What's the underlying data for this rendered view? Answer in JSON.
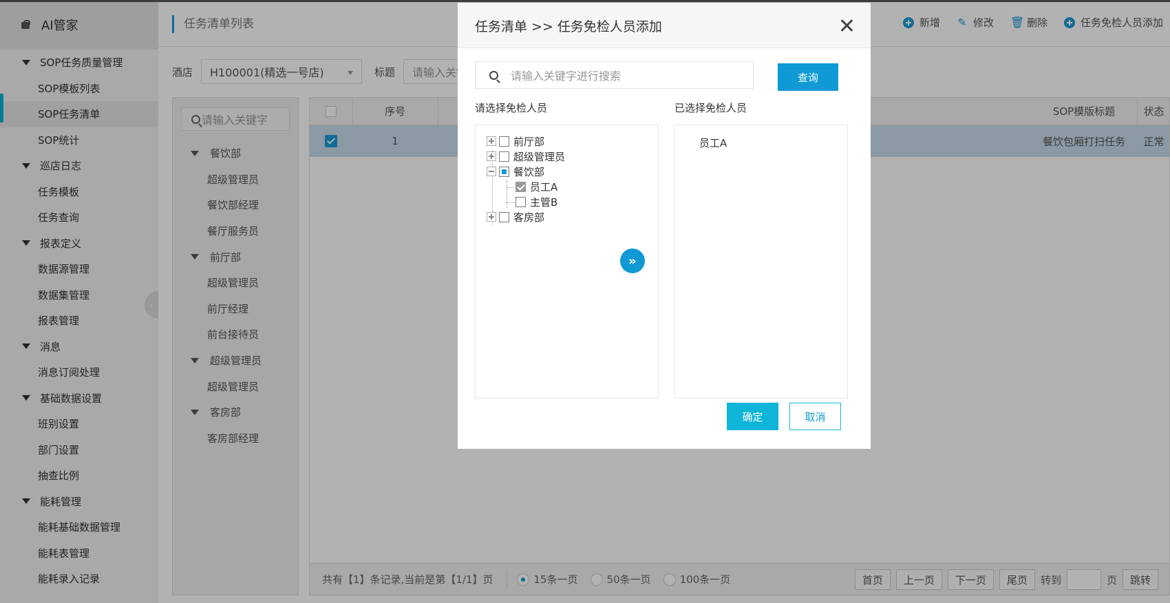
{
  "sidebar": {
    "brand": "AI管家",
    "items": [
      {
        "label": "SOP任务质量管理",
        "type": "group"
      },
      {
        "label": "SOP模板列表",
        "type": "child"
      },
      {
        "label": "SOP任务清单",
        "type": "child",
        "active": true
      },
      {
        "label": "SOP统计",
        "type": "child"
      },
      {
        "label": "巡店日志",
        "type": "group"
      },
      {
        "label": "任务模板",
        "type": "child"
      },
      {
        "label": "任务查询",
        "type": "child"
      },
      {
        "label": "报表定义",
        "type": "group"
      },
      {
        "label": "数据源管理",
        "type": "child"
      },
      {
        "label": "数据集管理",
        "type": "child"
      },
      {
        "label": "报表管理",
        "type": "child"
      },
      {
        "label": "消息",
        "type": "group"
      },
      {
        "label": "消息订阅处理",
        "type": "child"
      },
      {
        "label": "基础数据设置",
        "type": "group"
      },
      {
        "label": "班别设置",
        "type": "child"
      },
      {
        "label": "部门设置",
        "type": "child"
      },
      {
        "label": "抽查比例",
        "type": "child"
      },
      {
        "label": "能耗管理",
        "type": "group"
      },
      {
        "label": "能耗基础数据管理",
        "type": "child"
      },
      {
        "label": "能耗表管理",
        "type": "child"
      },
      {
        "label": "能耗录入记录",
        "type": "child"
      }
    ]
  },
  "header": {
    "title": "任务清单列表",
    "toolbar": {
      "add": "新增",
      "edit": "修改",
      "delete": "删除",
      "add_exempt": "任务免检人员添加"
    }
  },
  "filters": {
    "hotel_label": "酒店",
    "hotel_value": "H100001(精选一号店)",
    "title_label": "标题",
    "title_placeholder": "请输入关键"
  },
  "org_tree": {
    "search_placeholder": "请输入关键字",
    "items": [
      {
        "label": "餐饮部",
        "type": "dept"
      },
      {
        "label": "超级管理员",
        "type": "role"
      },
      {
        "label": "餐饮部经理",
        "type": "role"
      },
      {
        "label": "餐厅服务员",
        "type": "role"
      },
      {
        "label": "前厅部",
        "type": "dept"
      },
      {
        "label": "超级管理员",
        "type": "role"
      },
      {
        "label": "前厅经理",
        "type": "role"
      },
      {
        "label": "前台接待员",
        "type": "role"
      },
      {
        "label": "超级管理员",
        "type": "dept"
      },
      {
        "label": "超级管理员",
        "type": "role"
      },
      {
        "label": "客房部",
        "type": "dept"
      },
      {
        "label": "客房部经理",
        "type": "role"
      }
    ]
  },
  "table": {
    "columns": {
      "seq": "序号",
      "sop_title": "SOP模版标题",
      "status": "状态"
    },
    "rows": [
      {
        "checked": true,
        "seq": "1",
        "sop_title": "餐饮包厢打扫任务",
        "status": "正常"
      }
    ],
    "footer": {
      "records": "共有【1】条记录,当前是第【1/1】页",
      "page_sizes": [
        "15条一页",
        "50条一页",
        "100条一页"
      ],
      "selected_page_size": "15条一页",
      "first": "首页",
      "prev": "上一页",
      "next": "下一页",
      "last": "尾页",
      "goto_label": "转到",
      "page_unit": "页",
      "jump": "跳转"
    }
  },
  "modal": {
    "title": "任务清单 >> 任务免检人员添加",
    "search_placeholder": "请输入关键字进行搜索",
    "query_label": "查询",
    "left_label": "请选择免检人员",
    "right_label": "已选择免检人员",
    "tree": {
      "front": "前厅部",
      "admin": "超级管理员",
      "food": "餐饮部",
      "staff_a": "员工A",
      "manager_b": "主管B",
      "rooms": "客房部"
    },
    "move_icon": "»",
    "selected": [
      "员工A"
    ],
    "ok_label": "确定",
    "cancel_label": "取消"
  },
  "colors": {
    "accent": "#0f9ad6",
    "confirm": "#0fb5d8",
    "row_selected": "#c8dbeb"
  }
}
